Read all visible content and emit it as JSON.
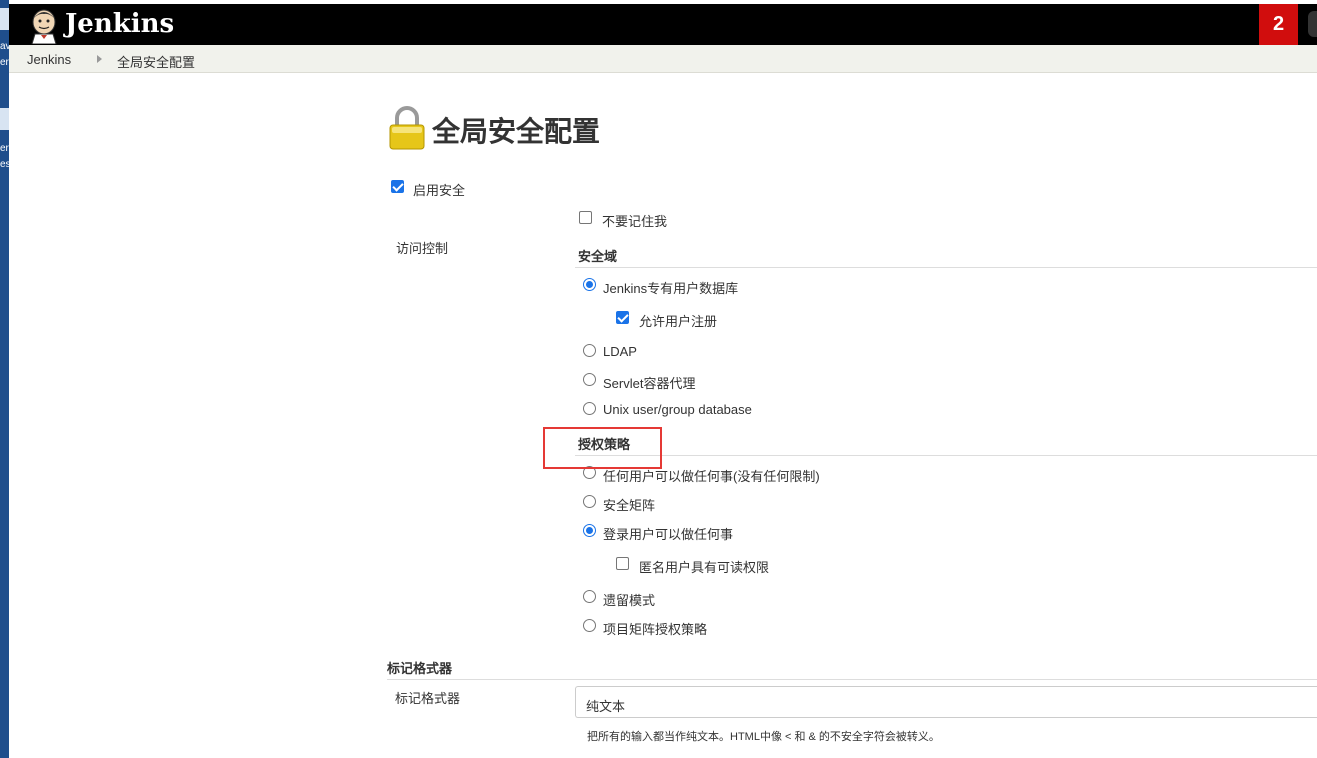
{
  "app": {
    "name": "Jenkins",
    "notification_count": "2"
  },
  "desktop_fragments": [
    "av",
    "er",
    "er",
    "es"
  ],
  "breadcrumb": {
    "items": [
      "Jenkins",
      "全局安全配置"
    ]
  },
  "page": {
    "title": "全局安全配置"
  },
  "enable_security": {
    "label": "启用安全",
    "checked": true
  },
  "access_control": {
    "label": "访问控制",
    "remember_me": {
      "label": "不要记住我",
      "checked": false
    },
    "security_realm": {
      "title": "安全域",
      "options": [
        {
          "label": "Jenkins专有用户数据库",
          "selected": true
        },
        {
          "label": "LDAP",
          "selected": false
        },
        {
          "label": "Servlet容器代理",
          "selected": false
        },
        {
          "label": "Unix user/group database",
          "selected": false
        }
      ],
      "allow_signup": {
        "label": "允许用户注册",
        "checked": true
      }
    },
    "authorization": {
      "title": "授权策略",
      "options": [
        {
          "label": "任何用户可以做任何事(没有任何限制)",
          "selected": false
        },
        {
          "label": "安全矩阵",
          "selected": false
        },
        {
          "label": "登录用户可以做任何事",
          "selected": true
        },
        {
          "label": "遗留模式",
          "selected": false
        },
        {
          "label": "项目矩阵授权策略",
          "selected": false
        }
      ],
      "anonymous_read": {
        "label": "匿名用户具有可读权限",
        "checked": false
      }
    }
  },
  "markup_formatter": {
    "section_title": "标记格式器",
    "field_label": "标记格式器",
    "value": "纯文本",
    "help": "把所有的输入都当作纯文本。HTML中像 < 和 & 的不安全字符会被转义。"
  },
  "colors": {
    "header": "#000000",
    "badge": "#d10d0d",
    "accent": "#1a73e8",
    "highlight": "#e53935"
  }
}
